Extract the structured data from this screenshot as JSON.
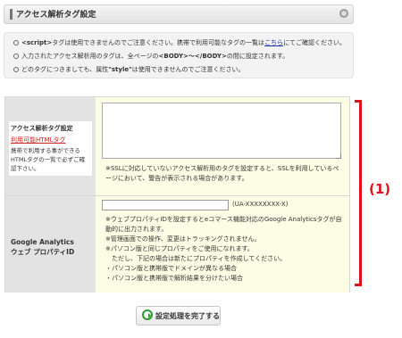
{
  "header": {
    "title": "アクセス解析タグ設定"
  },
  "notice": {
    "lines": [
      {
        "prefix": "",
        "strong": "<script>",
        "middle": "タグは使用できませんのでご注意ください。携帯で利用可能なタグの一覧は",
        "link": "こちら",
        "suffix": "にてご確認ください。"
      },
      {
        "prefix": "入力されたアクセス解析用のタグは、全ページの",
        "strong": "<BODY>〜</BODY>",
        "middle": "の間に設定されます。",
        "link": "",
        "suffix": ""
      },
      {
        "prefix": "どのタグにつきましても、属性",
        "strong": "\"style\"",
        "middle": "は使用できませんのでご注意ください。",
        "link": "",
        "suffix": ""
      }
    ]
  },
  "form": {
    "tag_setting": {
      "label": "アクセス解析タグ設定",
      "link": "利用可能HTMLタグ",
      "hint": "携帯で利用する事ができるHTMLタグの一覧で必ずご確認下さい。",
      "textarea_value": "",
      "help": "※SSLに対応していないアクセス解析用のタグを設定すると、SSLを利用しているページにおいて、警告が表示される場合があります。"
    },
    "google_analytics": {
      "label_line1": "Google Analytics",
      "label_line2": "ウェブ プロパティID",
      "input_value": "",
      "format": "(UA-XXXXXXXX-X)",
      "help": "※ウェブプロパティIDを設定するとeコマース機能対応のGoogle Analyticsタグが自動的に出力されます。\n※管理画面での操作、変更はトラッキングされません。\n※パソコン版と同じプロパティをご使用になれます。\n　ただし、下記の場合は新たにプロパティを作成してください。\n・パソコン版と携帯版でドメインが異なる場合\n・パソコン版と携帯版で解析結果を分けたい場合"
    }
  },
  "annotation": {
    "label": "(1)",
    "color": "#e0101f"
  },
  "submit": {
    "label": "設定処理を完了する",
    "icon": "refresh-icon"
  }
}
